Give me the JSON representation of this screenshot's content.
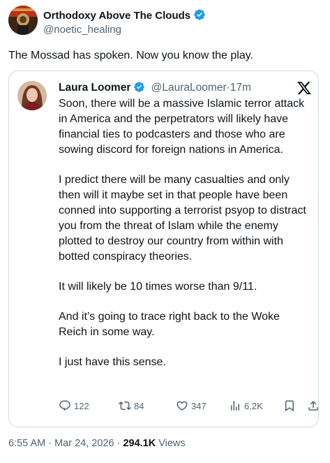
{
  "post": {
    "author_name": "Orthodoxy Above The Clouds",
    "author_handle": "@noetic_healing",
    "text": "The Mossad has spoken. Now you know the play."
  },
  "quote": {
    "author_name": "Laura Loomer",
    "author_handle": "@LauraLoomer",
    "separator": "·",
    "time": "17m",
    "paragraphs": [
      "Soon, there will be a massive Islamic terror attack in America and the perpetrators will likely have financial ties to podcasters and those who are sowing discord for foreign nations in America.",
      "I predict there will be many casualties and only then will it maybe set in that people have been conned into supporting a terrorist psyop to distract you from the threat of Islam while the enemy plotted to destroy our country from within with botted conspiracy theories.",
      "It will likely be 10 times worse than 9/11.",
      "And it’s going to trace right back to the Woke Reich in some way.",
      "I just have this sense."
    ],
    "actions": {
      "replies": "122",
      "reposts": "84",
      "likes": "347",
      "views": "6.2K"
    }
  },
  "meta": {
    "time": "6:55 AM",
    "dot1": " · ",
    "date": "Mar 24, 2026",
    "dot2": " · ",
    "views_count": "294.1K",
    "views_label": " Views"
  },
  "colors": {
    "verified": "#1d9bf0",
    "secondary_text": "#536471",
    "border": "#cfd9de"
  },
  "icons": [
    "verified-badge-icon",
    "x-logo-icon",
    "reply-icon",
    "repost-icon",
    "like-icon",
    "views-icon",
    "bookmark-icon",
    "share-icon"
  ]
}
